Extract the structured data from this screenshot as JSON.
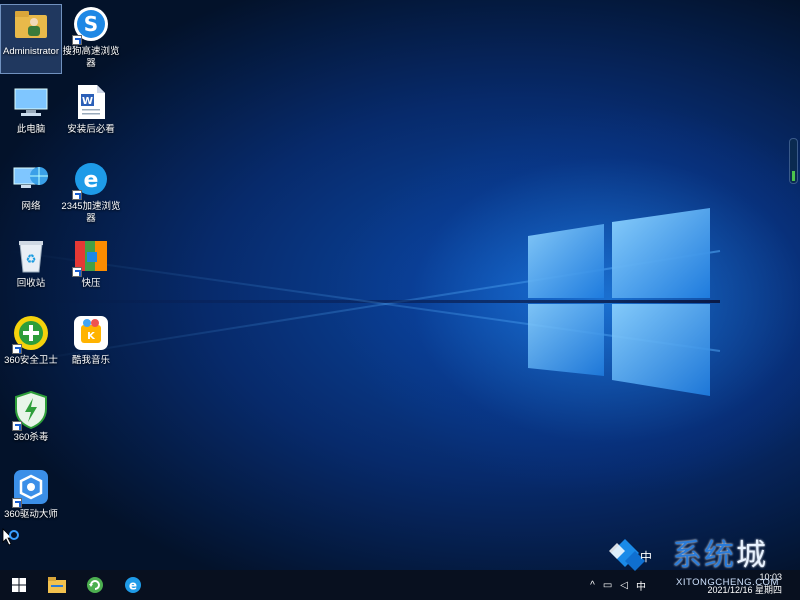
{
  "desktop": {
    "icons": [
      {
        "label": "Administrator",
        "icon": "folder-user-icon"
      },
      {
        "label": "搜狗高速浏览器",
        "icon": "sogou-browser-icon"
      },
      {
        "label": "此电脑",
        "icon": "computer-icon"
      },
      {
        "label": "安装后必看",
        "icon": "word-document-icon"
      },
      {
        "label": "网络",
        "icon": "network-icon"
      },
      {
        "label": "2345加速浏览器",
        "icon": "ie-browser-icon"
      },
      {
        "label": "回收站",
        "icon": "recycle-bin-icon"
      },
      {
        "label": "快压",
        "icon": "kuaiya-icon"
      },
      {
        "label": "360安全卫士",
        "icon": "360-safe-icon"
      },
      {
        "label": "酷我音乐",
        "icon": "kuwo-music-icon"
      },
      {
        "label": "360杀毒",
        "icon": "360-antivirus-icon"
      },
      {
        "label": "360驱动大师",
        "icon": "360-driver-icon"
      }
    ]
  },
  "taskbar": {
    "buttons": [
      "windows-start-icon",
      "file-explorer-icon",
      "refresh-app-icon",
      "ie-browser-icon"
    ],
    "ime_label": "中",
    "tray_up": "^",
    "time": "10:03",
    "date": "2021/12/16 星期四"
  },
  "watermark": {
    "text": "系统",
    "text_highlight": "城",
    "url": "XITONGCHENG.COM",
    "ime_label": "中"
  },
  "colors": {
    "wallpaper": "#0b4aa8",
    "taskbar": "#08101f",
    "accent": "#1a5fd0"
  }
}
